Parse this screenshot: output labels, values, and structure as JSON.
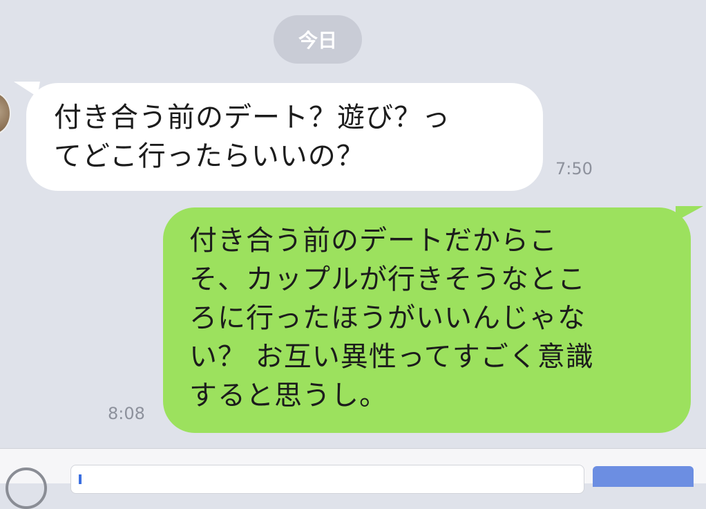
{
  "date_separator": {
    "label": "今日"
  },
  "messages": [
    {
      "direction": "incoming",
      "lines": [
        "付き合う前のデート？遊び？っ",
        "てどこ行ったらいいの？"
      ],
      "time": "7:50"
    },
    {
      "direction": "outgoing",
      "lines": [
        "付き合う前のデートだからこ",
        "そ、カップルが行きそうなとこ",
        "ろに行ったほうがいいんじゃな",
        "い？ お互い異性ってすごく意識",
        "すると思うし。"
      ],
      "time": "8:08"
    }
  ],
  "colors": {
    "background": "#dfe2ea",
    "incoming_bubble": "#ffffff",
    "outgoing_bubble": "#9ce15e",
    "date_pill": "#c9ccd6",
    "timestamp": "#8d919c"
  },
  "input_bar": {
    "text_value": "",
    "icons": [
      "plus-icon",
      "send-icon"
    ]
  }
}
